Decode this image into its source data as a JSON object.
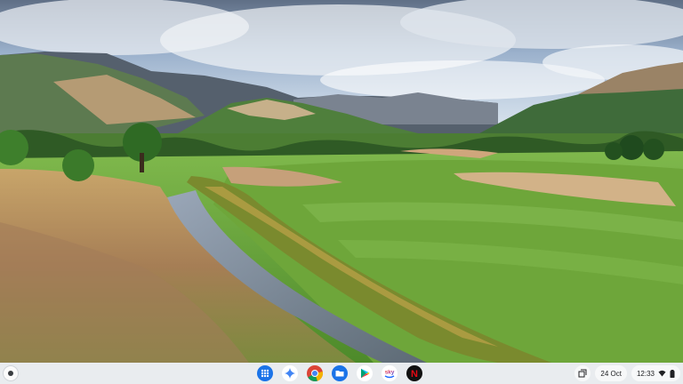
{
  "shelf": {
    "launcher_icon": "launcher-icon",
    "pinned_apps": [
      {
        "name": "app-launcher-grid",
        "icon": "apps-grid-icon",
        "color": "#1a73e8"
      },
      {
        "name": "gemini",
        "icon": "gemini-icon",
        "color": "#4285f4"
      },
      {
        "name": "chrome",
        "icon": "chrome-icon"
      },
      {
        "name": "files",
        "icon": "files-icon",
        "color": "#1a73e8"
      },
      {
        "name": "play-store",
        "icon": "play-store-icon"
      },
      {
        "name": "sky",
        "icon": "sky-icon",
        "label": "sky"
      },
      {
        "name": "netflix",
        "icon": "netflix-icon",
        "label": "N",
        "color": "#e50914"
      }
    ]
  },
  "tray": {
    "date": "24 Oct",
    "time": "12:33"
  }
}
